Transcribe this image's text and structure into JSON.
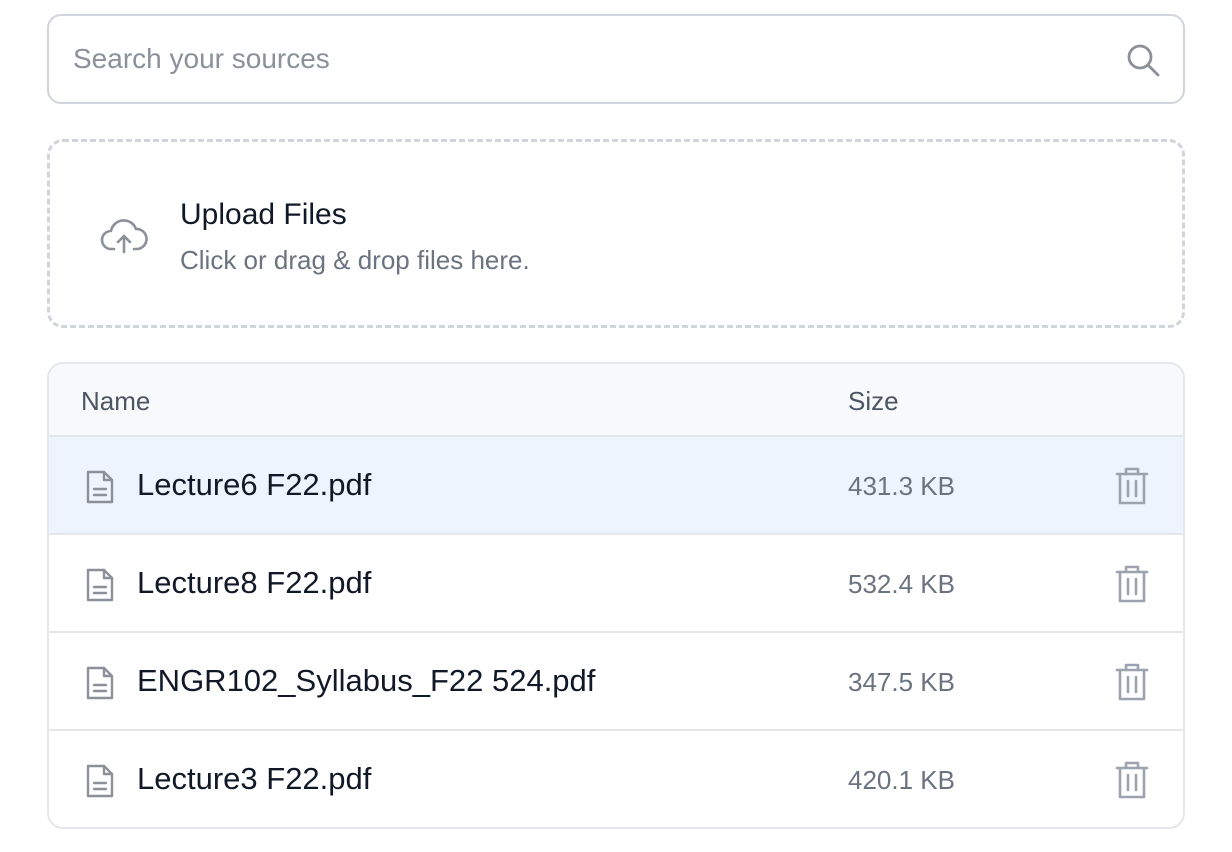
{
  "search": {
    "placeholder": "Search your sources",
    "value": "",
    "icon": "search-icon"
  },
  "upload": {
    "icon": "cloud-upload-icon",
    "title": "Upload Files",
    "subtitle": "Click or drag & drop files here."
  },
  "table": {
    "columns": [
      "Name",
      "Size"
    ],
    "rows": [
      {
        "name": "Lecture6 F22.pdf",
        "size": "431.3 KB",
        "selected": true
      },
      {
        "name": "Lecture8 F22.pdf",
        "size": "532.4 KB",
        "selected": false
      },
      {
        "name": "ENGR102_Syllabus_F22 524.pdf",
        "size": "347.5 KB",
        "selected": false
      },
      {
        "name": "Lecture3 F22.pdf",
        "size": "420.1 KB",
        "selected": false
      }
    ],
    "row_icon": "file-text-icon",
    "delete_icon": "trash-icon"
  },
  "colors": {
    "selected_row": "#eef4fd",
    "border": "#d1d5db",
    "muted_text": "#6b7280",
    "icon": "#8b9099"
  }
}
